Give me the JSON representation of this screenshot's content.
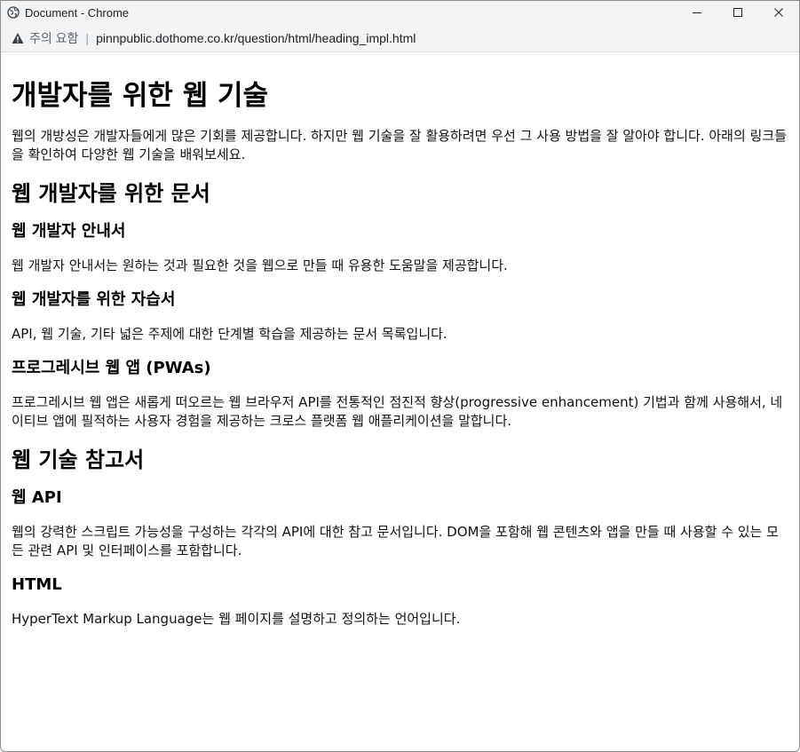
{
  "window": {
    "title": "Document - Chrome",
    "controls": {
      "minimize": "–",
      "maximize": "☐",
      "close": "✕"
    }
  },
  "address": {
    "warning": "주의 요함",
    "url": "pinnpublic.dothome.co.kr/question/html/heading_impl.html"
  },
  "page": {
    "h1": "개발자를 위한 웹 기술",
    "intro": "웹의 개방성은 개발자들에게 많은 기회를 제공합니다. 하지만 웹 기술을 잘 활용하려면 우선 그 사용 방법을 잘 알아야 합니다. 아래의 링크들을 확인하여 다양한 웹 기술을 배워보세요.",
    "section1": {
      "title": "웹 개발자를 위한 문서",
      "items": [
        {
          "title": "웹 개발자 안내서",
          "desc": "웹 개발자 안내서는 원하는 것과 필요한 것을 웹으로 만들 때 유용한 도움말을 제공합니다."
        },
        {
          "title": "웹 개발자를 위한 자습서",
          "desc": "API, 웹 기술, 기타 넓은 주제에 대한 단계별 학습을 제공하는 문서 목록입니다."
        },
        {
          "title": "프로그레시브 웹 앱 (PWAs)",
          "desc": "프로그레시브 웹 앱은 새롭게 떠오르는 웹 브라우저 API를 전통적인 점진적 향상(progressive enhancement) 기법과 함께 사용해서, 네이티브 앱에 필적하는 사용자 경험을 제공하는 크로스 플랫폼 웹 애플리케이션을 말합니다."
        }
      ]
    },
    "section2": {
      "title": "웹 기술 참고서",
      "items": [
        {
          "title": "웹 API",
          "desc": "웹의 강력한 스크립트 가능성을 구성하는 각각의 API에 대한 참고 문서입니다. DOM을 포함해 웹 콘텐츠와 앱을 만들 때 사용할 수 있는 모든 관련 API 및 인터페이스를 포함합니다."
        },
        {
          "title": "HTML",
          "desc": "HyperText Markup Language는 웹 페이지를 설명하고 정의하는 언어입니다."
        }
      ]
    }
  }
}
